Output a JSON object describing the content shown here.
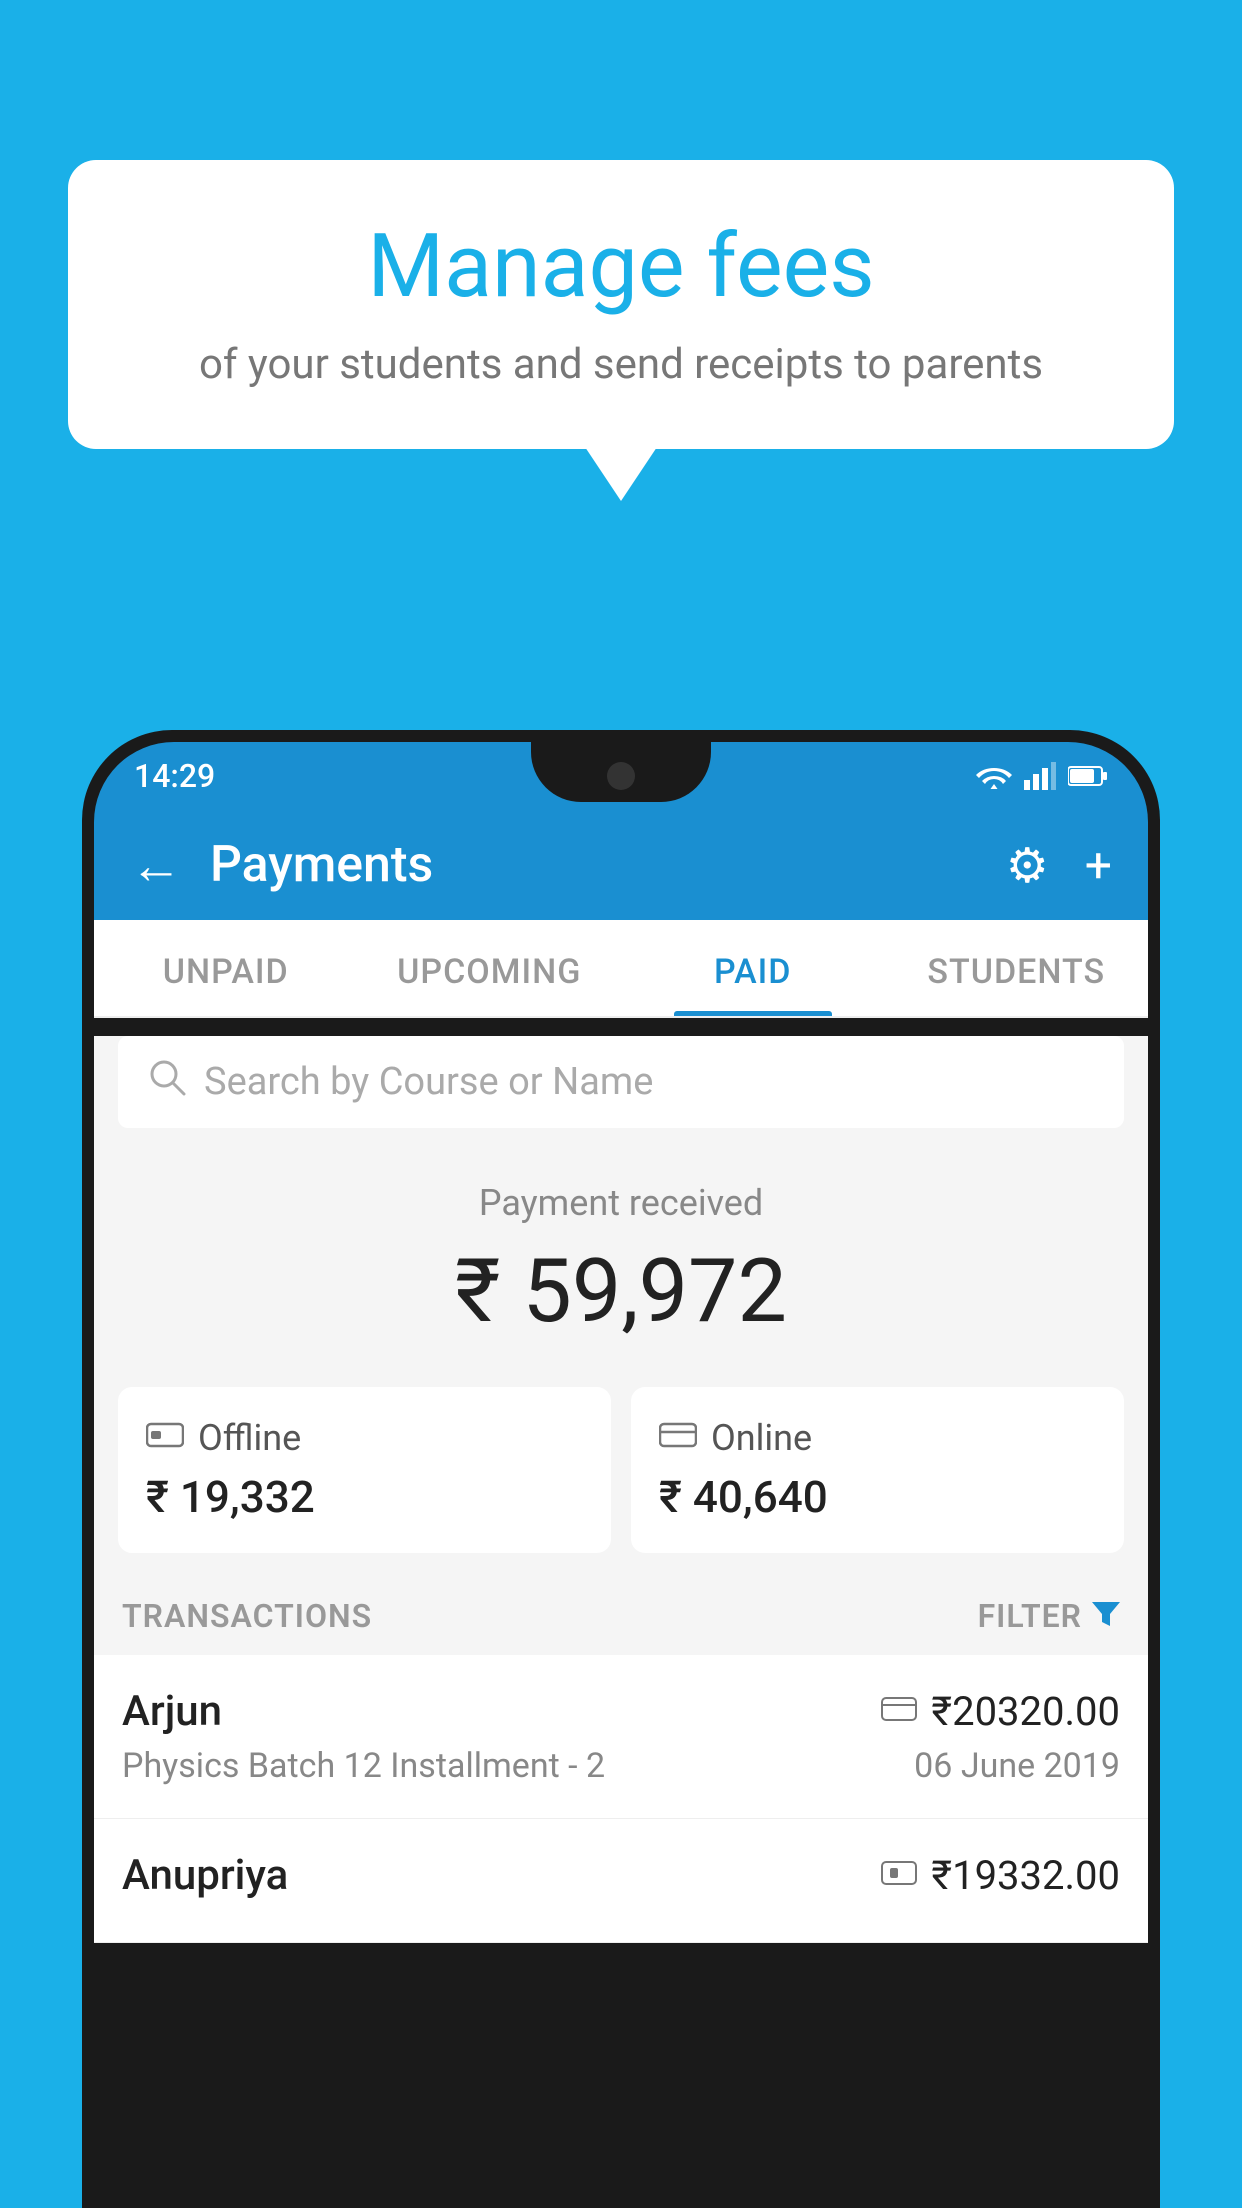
{
  "background_color": "#1ab0e8",
  "bubble": {
    "title": "Manage fees",
    "subtitle": "of your students and send receipts to parents"
  },
  "status_bar": {
    "time": "14:29"
  },
  "app_bar": {
    "title": "Payments",
    "back_icon": "←",
    "gear_icon": "⚙",
    "plus_icon": "+"
  },
  "tabs": [
    {
      "label": "UNPAID",
      "active": false
    },
    {
      "label": "UPCOMING",
      "active": false
    },
    {
      "label": "PAID",
      "active": true
    },
    {
      "label": "STUDENTS",
      "active": false
    }
  ],
  "search": {
    "placeholder": "Search by Course or Name"
  },
  "payment_received": {
    "label": "Payment received",
    "amount": "₹ 59,972"
  },
  "payment_cards": [
    {
      "icon": "offline",
      "label": "Offline",
      "amount": "₹ 19,332"
    },
    {
      "icon": "online",
      "label": "Online",
      "amount": "₹ 40,640"
    }
  ],
  "transactions_header": {
    "label": "TRANSACTIONS",
    "filter_label": "FILTER"
  },
  "transactions": [
    {
      "name": "Arjun",
      "description": "Physics Batch 12 Installment - 2",
      "amount": "₹20320.00",
      "date": "06 June 2019",
      "icon": "card"
    },
    {
      "name": "Anupriya",
      "description": "",
      "amount": "₹19332.00",
      "date": "",
      "icon": "cash"
    }
  ]
}
